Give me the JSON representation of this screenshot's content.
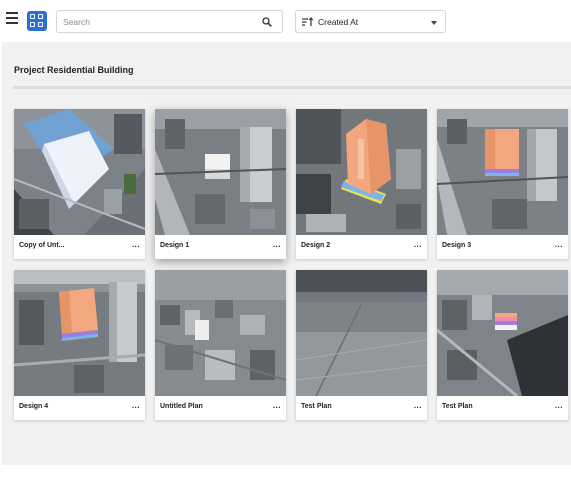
{
  "toolbar": {
    "search_placeholder": "Search",
    "sort_label": "Created At"
  },
  "project": {
    "title": "Project Residential Building"
  },
  "plans": [
    {
      "name": "Copy of Unt...",
      "more": "..."
    },
    {
      "name": "Design 1",
      "more": "..."
    },
    {
      "name": "Design 2",
      "more": "..."
    },
    {
      "name": "Design 3",
      "more": "..."
    },
    {
      "name": "Design 4",
      "more": "..."
    },
    {
      "name": "Untitled Plan",
      "more": "..."
    },
    {
      "name": "Test Plan",
      "more": "..."
    },
    {
      "name": "Test Plan",
      "more": "..."
    }
  ],
  "colors": {
    "accent": "#2b6fd6",
    "page_background": "#f1f1f1",
    "building_orange": "#f2a77e"
  }
}
